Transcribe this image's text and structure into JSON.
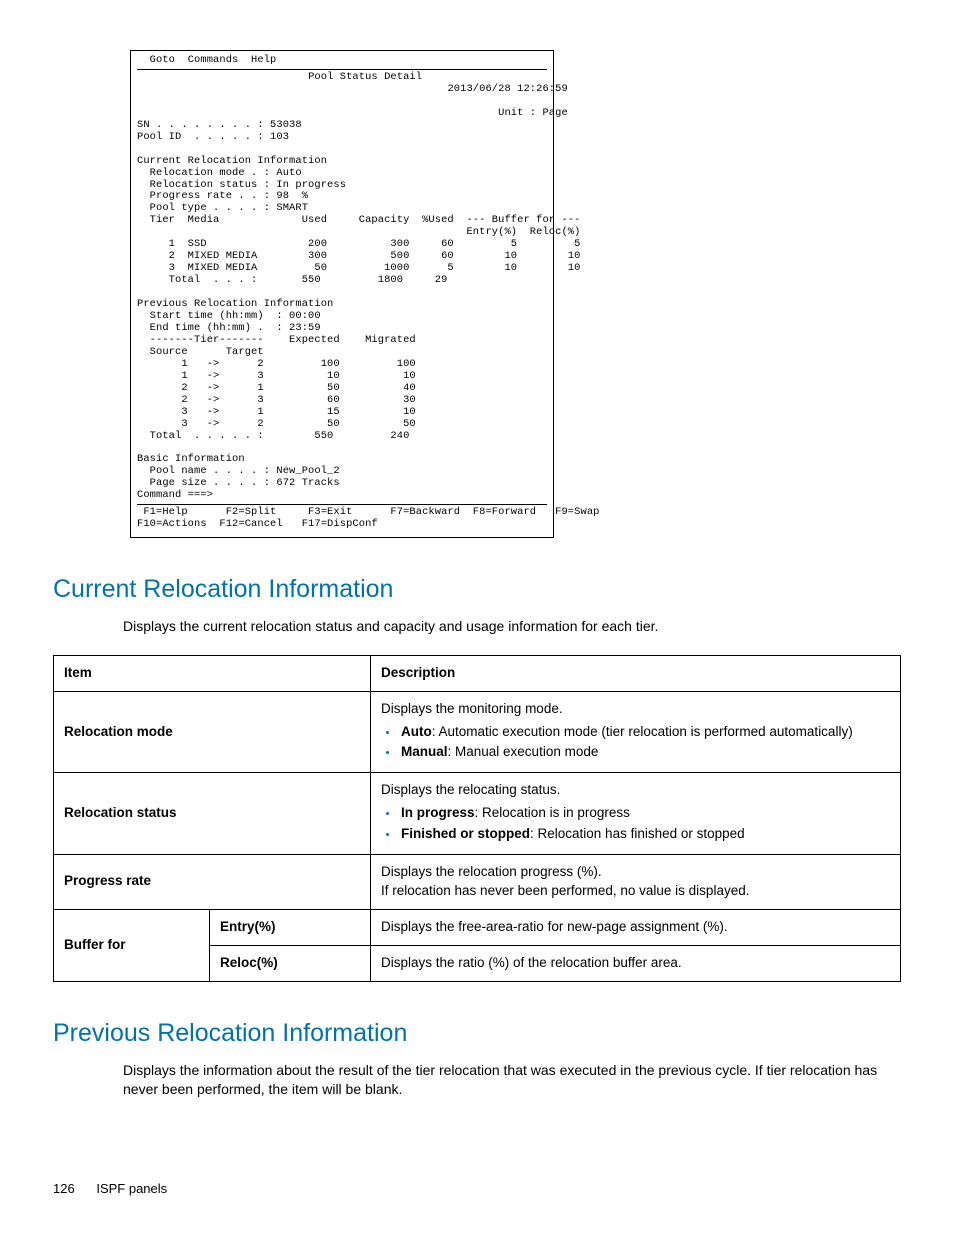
{
  "terminal": {
    "menu1": "Goto",
    "menu2": "Commands",
    "menu3": "Help",
    "title": "Pool Status Detail",
    "datetime": "2013/06/28 12:26:59",
    "unit_label": "Unit : Page",
    "sn_label": "SN . . . . . . . . : 53038",
    "pool_id_label": "Pool ID  . . . . . : 103",
    "cri_title": "Current Relocation Information",
    "reloc_mode": "  Relocation mode . : Auto",
    "reloc_status": "  Relocation status : In progress",
    "progress": "  Progress rate . . : 98  %",
    "pool_type": "  Pool type . . . . : SMART",
    "tier_header1": "  Tier  Media             Used     Capacity  %Used  --- Buffer for ---",
    "tier_header2": "                                                    Entry(%)  Reloc(%)",
    "tier_row1": "     1  SSD                200          300     60         5         5",
    "tier_row2": "     2  MIXED MEDIA        300          500     60        10        10",
    "tier_row3": "     3  MIXED MEDIA         50         1000      5        10        10",
    "tier_total": "     Total  . . . :       550         1800     29",
    "pri_title": "Previous Relocation Information",
    "start_time": "  Start time (hh:mm)  : 00:00",
    "end_time": "  End time (hh:mm) .  : 23:59",
    "mig_hdr1": "  -------Tier-------    Expected    Migrated",
    "mig_hdr2": "  Source      Target",
    "mig_r1": "       1   ->      2         100         100",
    "mig_r2": "       1   ->      3          10          10",
    "mig_r3": "       2   ->      1          50          40",
    "mig_r4": "       2   ->      3          60          30",
    "mig_r5": "       3   ->      1          15          10",
    "mig_r6": "       3   ->      2          50          50",
    "mig_total": "  Total  . . . . . :        550         240",
    "basic_title": "Basic Information",
    "pool_name": "  Pool name . . . . : New_Pool_2",
    "page_size": "  Page size . . . . : 672 Tracks",
    "cmd": "Command ===>",
    "fkeys1": " F1=Help      F2=Split     F3=Exit      F7=Backward  F8=Forward   F9=Swap",
    "fkeys2": "F10=Actions  F12=Cancel   F17=DispConf"
  },
  "section1": {
    "heading": "Current Relocation Information",
    "intro": "Displays the current relocation status and capacity and usage information for each tier.",
    "th_item": "Item",
    "th_desc": "Description",
    "r1_item": "Relocation mode",
    "r1_d1": "Displays the monitoring mode.",
    "r1_b1b": "Auto",
    "r1_b1t": ": Automatic execution mode (tier relocation is performed automatically)",
    "r1_b2b": "Manual",
    "r1_b2t": ": Manual execution mode",
    "r2_item": "Relocation status",
    "r2_d1": "Displays the relocating status.",
    "r2_b1b": "In progress",
    "r2_b1t": ": Relocation is in progress",
    "r2_b2b": "Finished or stopped",
    "r2_b2t": ": Relocation has finished or stopped",
    "r3_item": "Progress rate",
    "r3_d1": "Displays the relocation progress (%).",
    "r3_d2": "If relocation has never been performed, no value is displayed.",
    "r4_item": "Buffer for",
    "r4a_sub": "Entry(%)",
    "r4a_d": "Displays the free-area-ratio for new-page assignment (%).",
    "r4b_sub": "Reloc(%)",
    "r4b_d": "Displays the ratio (%) of the relocation buffer area."
  },
  "section2": {
    "heading": "Previous Relocation Information",
    "intro": "Displays the information about the result of the tier relocation that was executed in the previous cycle. If tier relocation has never been performed, the item will be blank."
  },
  "footer": {
    "page": "126",
    "title": "ISPF panels"
  }
}
